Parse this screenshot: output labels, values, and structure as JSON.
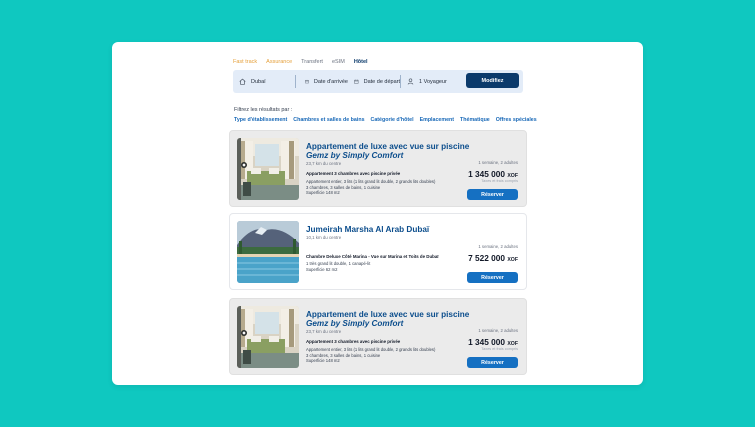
{
  "tabs": [
    {
      "label": "Fast track",
      "state": "orange"
    },
    {
      "label": "Assurance",
      "state": "orange"
    },
    {
      "label": "Transfert",
      "state": "normal"
    },
    {
      "label": "eSIM",
      "state": "normal"
    },
    {
      "label": "Hôtel",
      "state": "active"
    }
  ],
  "search": {
    "destination": "Dubaï",
    "arrival": "Date d'arrivée",
    "departure": "Date de départ",
    "travelers": "1 Voyageur",
    "button": "Modifiez"
  },
  "filters": {
    "title": "Filtrez les résultats par :",
    "items": [
      "Type d'établissement",
      "Chambres et salles de bains",
      "Catégorie d'hôtel",
      "Emplacement",
      "Thématique",
      "Offres spéciales"
    ]
  },
  "results": [
    {
      "title": "Appartement de luxe avec vue sur piscine",
      "subtitle": "Gemz by Simply Comfort",
      "distance": "23,7 km du centre",
      "room": "Appartement 3 chambres avec piscine privée",
      "details": [
        "Appartement entier, 3 lits (1 lits grand lit double, 2 grands lits doubles)",
        "3 chambres, 3 salles de bains, 1 cuisine",
        "Superficie 148 m2"
      ],
      "stay": "1 semaine, 2 adultes",
      "price": "1 345 000",
      "currency": "XOF",
      "taxes": "Taxes et frais compris",
      "button": "Réserver",
      "image": "hotel-room-image"
    },
    {
      "title": "Jumeirah Marsha Al Arab Dubaï",
      "subtitle": "",
      "distance": "10,1 km du centre",
      "room": "Chambre Deluxe Côté Marina - Vue sur Marina et Toits de Dubaï",
      "details": [
        "1 très grand lit double, 1 canapé-lit",
        "Superficie 62 m2"
      ],
      "stay": "1 semaine, 2 adultes",
      "price": "7 522 000",
      "currency": "XOF",
      "taxes": "",
      "button": "Réserver",
      "image": "resort-pool-image"
    },
    {
      "title": "Appartement de luxe avec vue sur piscine",
      "subtitle": "Gemz by Simply Comfort",
      "distance": "23,7 km du centre",
      "room": "Appartement 3 chambres avec piscine privée",
      "details": [
        "Appartement entier, 3 lits (1 lits grand lit double, 2 grands lits doubles)",
        "3 chambres, 3 salles de bains, 1 cuisine",
        "Superficie 148 m2"
      ],
      "stay": "1 semaine, 2 adultes",
      "price": "1 345 000",
      "currency": "XOF",
      "taxes": "Taxes et frais compris",
      "button": "Réserver",
      "image": "hotel-room-image"
    }
  ],
  "colors": {
    "background": "#0fc8c0",
    "primary": "#0b3a6b",
    "accent_blue": "#1570c2",
    "link": "#1868b7",
    "orange": "#e5a03b"
  }
}
